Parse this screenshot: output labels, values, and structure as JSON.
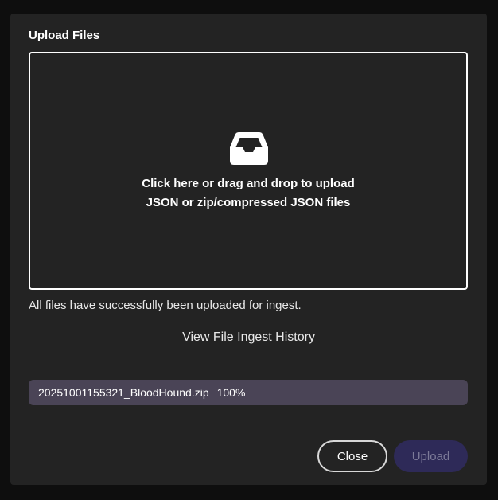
{
  "dialog": {
    "title": "Upload Files",
    "dropzone": {
      "icon": "inbox-tray-icon",
      "line1": "Click here or drag and drop to upload",
      "line2": "JSON or zip/compressed JSON files"
    },
    "status_message": "All files have successfully been uploaded for ingest.",
    "history_link": "View File Ingest History",
    "files": [
      {
        "name": "20251001155321_BloodHound.zip",
        "progress": "100%"
      }
    ],
    "buttons": {
      "close": "Close",
      "upload": "Upload"
    }
  },
  "colors": {
    "dialog_bg": "#232323",
    "file_row_bg": "#4a4456",
    "upload_button_bg": "#2e2a58",
    "upload_button_text": "#7c7a98"
  }
}
